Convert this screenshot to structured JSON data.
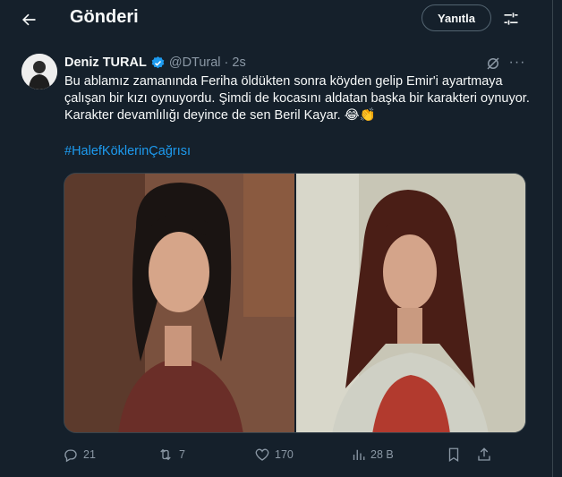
{
  "header": {
    "title": "Gönderi",
    "reply_label": "Yanıtla"
  },
  "tweet": {
    "name": "Deniz TURAL",
    "handle": "@DTural",
    "separator": "·",
    "time": "2s",
    "text": "Bu ablamız zamanında Feriha öldükten sonra köyden gelip Emir'i ayartmaya çalışan bir kızı oynuyordu. Şimdi de kocasını aldatan başka bir karakteri oynuyor. Karakter devamlılığı deyince de sen Beril Kayar. 😂👏",
    "hashtag": "#HalefKöklerinÇağrısı",
    "more": "···"
  },
  "stats": {
    "replies": "21",
    "reposts": "7",
    "likes": "170",
    "views": "28 B"
  },
  "icons": [
    "back-arrow-icon",
    "sliders-icon",
    "verified-badge-icon",
    "grok-icon",
    "more-icon",
    "reply-icon",
    "repost-icon",
    "like-icon",
    "views-icon",
    "bookmark-icon",
    "share-icon"
  ],
  "colors": {
    "background": "#15202b",
    "accent": "#1d9bf0",
    "muted": "#8b98a5",
    "text": "#f7f9f9"
  }
}
